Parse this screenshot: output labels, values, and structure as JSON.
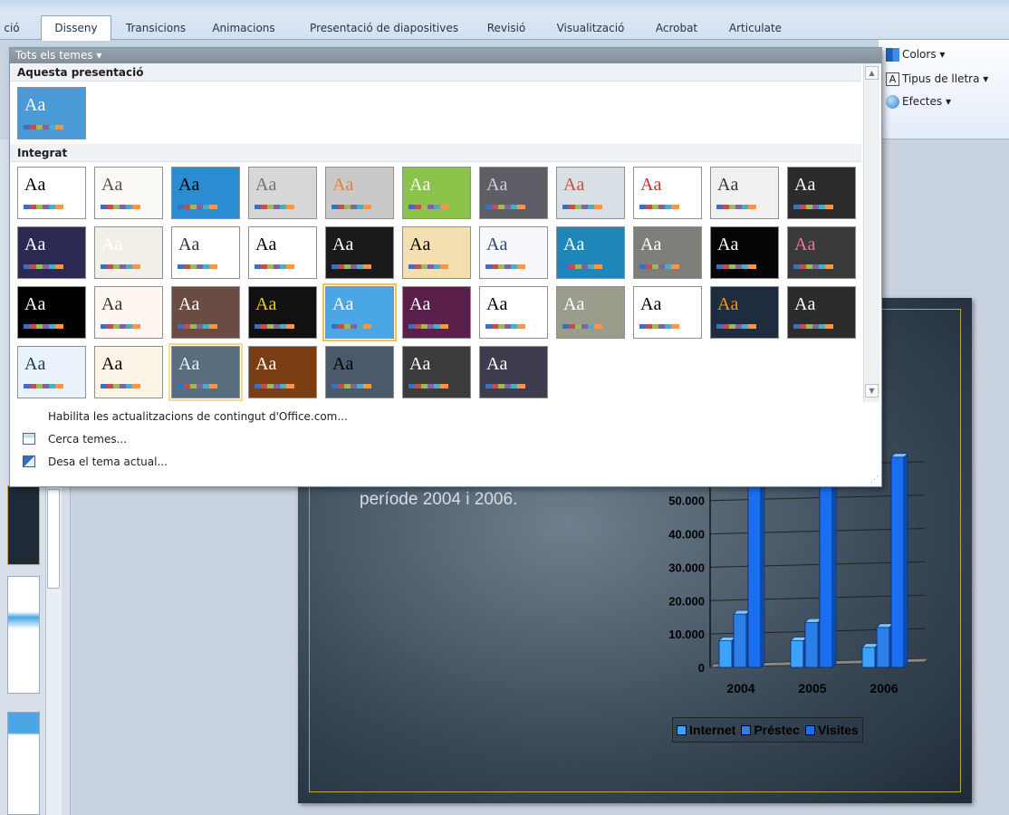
{
  "ribbon": {
    "tabs": [
      {
        "label": "ció",
        "active": false
      },
      {
        "label": "Disseny",
        "active": true
      },
      {
        "label": "Transicions",
        "active": false
      },
      {
        "label": "Animacions",
        "active": false
      },
      {
        "label": "Presentació de diapositives",
        "active": false
      },
      {
        "label": "Revisió",
        "active": false
      },
      {
        "label": "Visualització",
        "active": false
      },
      {
        "label": "Acrobat",
        "active": false
      },
      {
        "label": "Articulate",
        "active": false
      }
    ],
    "colors_label": "Colors ▾",
    "fonts_label": "Tipus de lletra ▾",
    "effects_label": "Efectes ▾"
  },
  "gallery": {
    "header": "Tots els temes ▾",
    "section_this": "Aquesta presentació",
    "section_builtin": "Integrat",
    "current_theme": {
      "text": "Aa",
      "bg": "#4a9ad6",
      "fg": "#ffffff"
    },
    "themes": [
      [
        {
          "text": "Aa",
          "bg": "#ffffff",
          "fg": "#000000"
        },
        {
          "text": "Aa",
          "bg": "#fbfaf6",
          "fg": "#5a4f3c"
        },
        {
          "text": "Aa",
          "bg": "#2a8dd2",
          "fg": "#000000"
        },
        {
          "text": "Aa",
          "bg": "#d7d7d7",
          "fg": "#6d7178"
        },
        {
          "text": "Aa",
          "bg": "#c9c9c9",
          "fg": "#f07a3a"
        },
        {
          "text": "Aa",
          "bg": "#8cc34a",
          "fg": "#ffffff"
        },
        {
          "text": "Aa",
          "bg": "#5e5e66",
          "fg": "#d0d0d0"
        },
        {
          "text": "Aa",
          "bg": "#d8e0e6",
          "fg": "#d44a3a"
        },
        {
          "text": "Aa",
          "bg": "#ffffff",
          "fg": "#c92f2f"
        },
        {
          "text": "Aa",
          "bg": "#f0f0f0",
          "fg": "#333333"
        },
        {
          "text": "Aa",
          "bg": "#2c2c2c",
          "fg": "#ffffff"
        }
      ],
      [
        {
          "text": "Aa",
          "bg": "#2c2a52",
          "fg": "#ffffff"
        },
        {
          "text": "Aa",
          "bg": "#f2efe8",
          "fg": "#ffffff"
        },
        {
          "text": "Aa",
          "bg": "#ffffff",
          "fg": "#333333"
        },
        {
          "text": "Aa",
          "bg": "#ffffff",
          "fg": "#000000"
        },
        {
          "text": "Aa",
          "bg": "#1a1a1a",
          "fg": "#ffffff"
        },
        {
          "text": "Aa",
          "bg": "#f4dfb0",
          "fg": "#000000"
        },
        {
          "text": "Aa",
          "bg": "#f6f8fb",
          "fg": "#2a4a6a"
        },
        {
          "text": "Aa",
          "bg": "#1e86b8",
          "fg": "#ffffff"
        },
        {
          "text": "Aa",
          "bg": "#7d8079",
          "fg": "#ffffff"
        },
        {
          "text": "Aa",
          "bg": "#050505",
          "fg": "#ffffff"
        },
        {
          "text": "Aa",
          "bg": "#3a3a3a",
          "fg": "#ff6ea8"
        }
      ],
      [
        {
          "text": "Aa",
          "bg": "#000000",
          "fg": "#ffffff"
        },
        {
          "text": "Aa",
          "bg": "#fdf6f1",
          "fg": "#333333"
        },
        {
          "text": "Aa",
          "bg": "#6b4c43",
          "fg": "#ffffff"
        },
        {
          "text": "Aa",
          "bg": "#111111",
          "fg": "#f6c91e"
        },
        {
          "text": "Aa",
          "bg": "#4aa6e4",
          "fg": "#ffffff"
        },
        {
          "text": "Aa",
          "bg": "#5b1f4c",
          "fg": "#ffffff"
        },
        {
          "text": "Aa",
          "bg": "#ffffff",
          "fg": "#000000"
        },
        {
          "text": "Aa",
          "bg": "#9a9c8c",
          "fg": "#ffffff"
        },
        {
          "text": "Aa",
          "bg": "#ffffff",
          "fg": "#000000"
        },
        {
          "text": "Aa",
          "bg": "#1d2c3e",
          "fg": "#f7941d"
        },
        {
          "text": "Aa",
          "bg": "#2c2c2c",
          "fg": "#ffffff"
        }
      ],
      [
        {
          "text": "Aa",
          "bg": "#eaf3fb",
          "fg": "#1a3a5a"
        },
        {
          "text": "Aa",
          "bg": "#faf3e6",
          "fg": "#000000"
        },
        {
          "text": "Aa",
          "bg": "#586d7e",
          "fg": "#e6f2ff"
        },
        {
          "text": "Aa",
          "bg": "#7a3e12",
          "fg": "#ffffff"
        },
        {
          "text": "Aa",
          "bg": "#4a5a6a",
          "fg": "#000000"
        },
        {
          "text": "Aa",
          "bg": "#3c3c3c",
          "fg": "#ffffff"
        },
        {
          "text": "Aa",
          "bg": "#3d3d4d",
          "fg": "#ffffff"
        }
      ]
    ],
    "menu": [
      {
        "label": "Habilita les actualitzacions de contingut d'Office.com..."
      },
      {
        "label": "Cerca temes..."
      },
      {
        "label": "Desa el tema actual..."
      }
    ]
  },
  "slide": {
    "text": "període 2004 i 2006."
  },
  "chart_data": {
    "type": "bar",
    "categories": [
      "2004",
      "2005",
      "2006"
    ],
    "series": [
      {
        "name": "Internet",
        "values": [
          8000,
          8000,
          6000
        ]
      },
      {
        "name": "Préstec",
        "values": [
          16000,
          13500,
          12000
        ]
      },
      {
        "name": "Visites",
        "values": [
          70000,
          70000,
          63000
        ]
      }
    ],
    "ytick_labels": [
      "0",
      "10.000",
      "20.000",
      "30.000",
      "40.000",
      "50.000",
      "60.000"
    ],
    "ylim": [
      0,
      70000
    ],
    "colors": [
      "#3ba2ff",
      "#2c7fe8",
      "#1a6ef0"
    ]
  }
}
